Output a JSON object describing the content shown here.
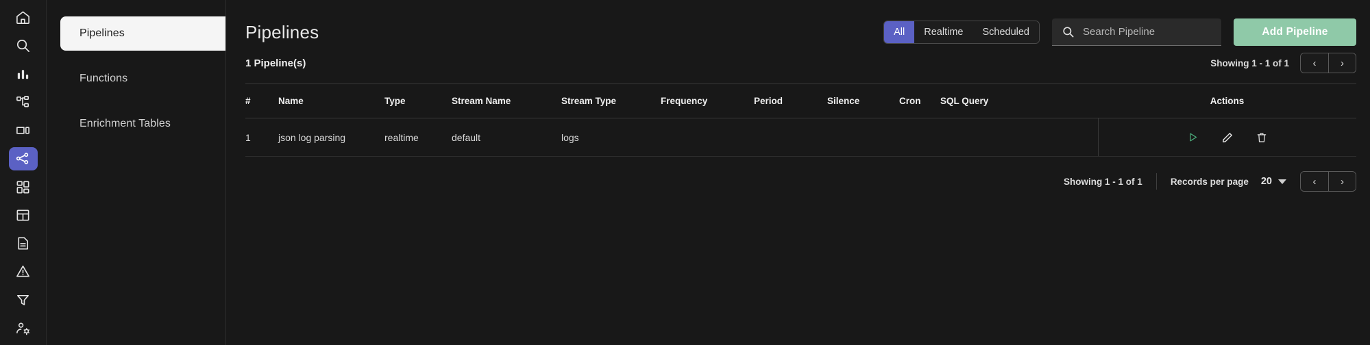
{
  "rail": {
    "items": [
      {
        "name": "home-icon",
        "label": "Home",
        "active": false
      },
      {
        "name": "search-icon",
        "label": "Search",
        "active": false
      },
      {
        "name": "bar-chart-icon",
        "label": "Metrics",
        "active": false
      },
      {
        "name": "traces-icon",
        "label": "Traces",
        "active": false
      },
      {
        "name": "rum-icon",
        "label": "RUM",
        "active": false
      },
      {
        "name": "share-nodes-icon",
        "label": "Pipelines",
        "active": true
      },
      {
        "name": "dashboard-icon",
        "label": "Dashboards",
        "active": false
      },
      {
        "name": "streams-icon",
        "label": "Streams",
        "active": false
      },
      {
        "name": "reports-icon",
        "label": "Reports",
        "active": false
      },
      {
        "name": "alerts-icon",
        "label": "Alerts",
        "active": false
      },
      {
        "name": "funnel-icon",
        "label": "Filters",
        "active": false
      },
      {
        "name": "user-settings-icon",
        "label": "IAM",
        "active": false
      }
    ],
    "active_color": "#5b61c4"
  },
  "subnav": {
    "items": [
      {
        "label": "Pipelines",
        "active": true
      },
      {
        "label": "Functions",
        "active": false
      },
      {
        "label": "Enrichment Tables",
        "active": false
      }
    ]
  },
  "header": {
    "title": "Pipelines",
    "filters": [
      {
        "label": "All",
        "active": true
      },
      {
        "label": "Realtime",
        "active": false
      },
      {
        "label": "Scheduled",
        "active": false
      }
    ],
    "search": {
      "placeholder": "Search Pipeline",
      "value": ""
    },
    "add_button": "Add Pipeline",
    "add_button_color": "#8fc9a8"
  },
  "toolbar": {
    "count_text": "1 Pipeline(s)",
    "showing_text": "Showing 1 - 1 of 1",
    "prev_glyph": "‹",
    "next_glyph": "›"
  },
  "table": {
    "columns": [
      "#",
      "Name",
      "Type",
      "Stream Name",
      "Stream Type",
      "Frequency",
      "Period",
      "Silence",
      "Cron",
      "SQL Query",
      "Actions"
    ],
    "rows": [
      {
        "index": "1",
        "name": "json log parsing",
        "type": "realtime",
        "stream_name": "default",
        "stream_type": "logs",
        "frequency": "",
        "period": "",
        "silence": "",
        "cron": "",
        "sql_query": "",
        "actions": [
          {
            "name": "play-icon",
            "label": "Start",
            "color": "#4caf7d"
          },
          {
            "name": "edit-pencil-icon",
            "label": "Edit",
            "color": "#e6e6e6"
          },
          {
            "name": "trash-icon",
            "label": "Delete",
            "color": "#e6e6e6"
          }
        ]
      }
    ]
  },
  "footer": {
    "showing_text": "Showing 1 - 1 of 1",
    "records_per_page_label": "Records per page",
    "records_per_page_value": "20",
    "prev_glyph": "‹",
    "next_glyph": "›"
  }
}
